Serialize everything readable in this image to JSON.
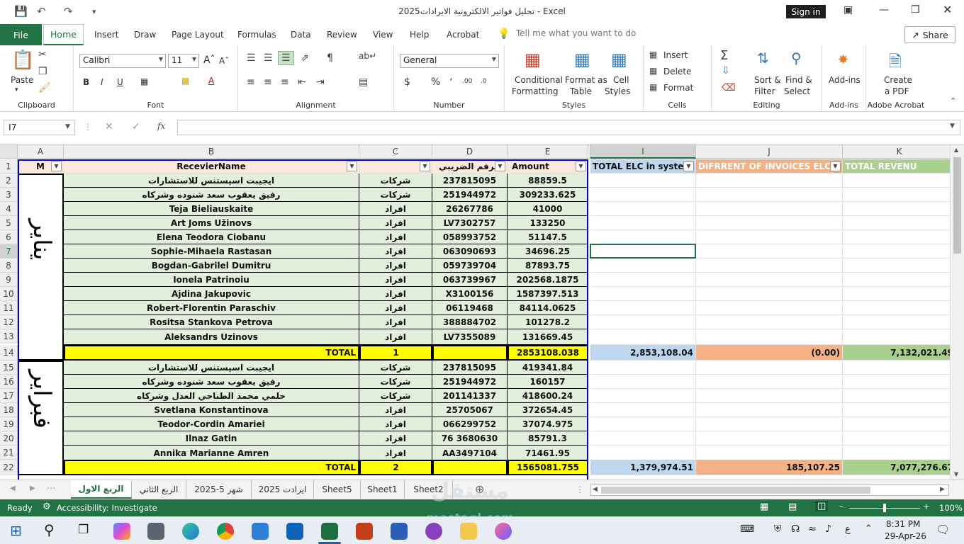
{
  "window": {
    "title": "تحليل فواتير الالكترونية الايرادات2025  -  Excel",
    "signin": "Sign in"
  },
  "tabs": {
    "file": "File",
    "home": "Home",
    "items": [
      "Insert",
      "Draw",
      "Page Layout",
      "Formulas",
      "Data",
      "Review",
      "View",
      "Help",
      "Acrobat"
    ],
    "tellme": "Tell me what you want to do",
    "share": "Share"
  },
  "ribbon": {
    "clipboard": {
      "label": "Clipboard",
      "paste": "Paste"
    },
    "font": {
      "label": "Font",
      "name": "Calibri",
      "size": "11"
    },
    "alignment": {
      "label": "Alignment"
    },
    "number": {
      "label": "Number",
      "format": "General"
    },
    "styles": {
      "label": "Styles",
      "cond1": "Conditional",
      "cond2": "Formatting",
      "fmt1": "Format as",
      "fmt2": "Table",
      "cell1": "Cell",
      "cell2": "Styles"
    },
    "cells": {
      "label": "Cells",
      "insert": "Insert",
      "delete": "Delete",
      "format": "Format"
    },
    "editing": {
      "label": "Editing",
      "sort1": "Sort &",
      "sort2": "Filter",
      "find1": "Find &",
      "find2": "Select"
    },
    "addins": {
      "label": "Add-ins",
      "btn": "Add-ins"
    },
    "acrobat": {
      "label": "Adobe Acrobat",
      "b1": "Create",
      "b2": "a PDF"
    }
  },
  "formula": {
    "namebox": "I7",
    "fx": "fx",
    "value": ""
  },
  "columns": [
    "A",
    "B",
    "C",
    "D",
    "E",
    "",
    "I",
    "J",
    "K"
  ],
  "header": {
    "a": "M",
    "b": "RecevierName",
    "c": "",
    "d": "الرقم الضريبي",
    "e": "Amount",
    "i": "TOTAL ELC in system",
    "j": "DIFRRENT OF INVOICES ELC",
    "k": "TOTAL REVENU"
  },
  "month1": "يناير",
  "month2": "فبراير",
  "rows1": [
    {
      "n": "2",
      "name": "ايجيبت اسيستنس للاستشارات",
      "type": "شركات",
      "tax": "237815095",
      "amount": "88859.5"
    },
    {
      "n": "3",
      "name": "رفيق يعقوب سعد شنوده وشركاه",
      "type": "شركات",
      "tax": "251944972",
      "amount": "309233.625"
    },
    {
      "n": "4",
      "name": "Teja Bieliauskaite",
      "type": "افراد",
      "tax": "26267786",
      "amount": "41000"
    },
    {
      "n": "5",
      "name": "Art Joms Užinovs",
      "type": "افراد",
      "tax": "LV7302757",
      "amount": "133250"
    },
    {
      "n": "6",
      "name": "Elena Teodora Ciobanu",
      "type": "افراد",
      "tax": "058993752",
      "amount": "51147.5"
    },
    {
      "n": "7",
      "name": "Sophie-Mihaela Rastasan",
      "type": "افراد",
      "tax": "063090693",
      "amount": "34696.25"
    },
    {
      "n": "8",
      "name": "Bogdan-Gabrilel Dumitru",
      "type": "افراد",
      "tax": "059739704",
      "amount": "87893.75"
    },
    {
      "n": "9",
      "name": "Ionela Patrinoiu",
      "type": "افراد",
      "tax": "063739967",
      "amount": "202568.1875"
    },
    {
      "n": "10",
      "name": "Ajdina Jakupovic",
      "type": "افراد",
      "tax": "X3100156",
      "amount": "1587397.513"
    },
    {
      "n": "11",
      "name": "Robert-Florentin Paraschiv",
      "type": "افراد",
      "tax": "06119468",
      "amount": "84114.0625"
    },
    {
      "n": "12",
      "name": "Rositsa Stankova Petrova",
      "type": "افراد",
      "tax": "388884702",
      "amount": "101278.2"
    },
    {
      "n": "13",
      "name": "Aleksandrs Uzinovs",
      "type": "افراد",
      "tax": "LV7355089",
      "amount": "131669.45"
    }
  ],
  "total1": {
    "n": "14",
    "label": "TOTAL",
    "c": "1",
    "amount": "2853108.038",
    "i": "2,853,108.04",
    "j": "(0.00)",
    "k": "7,132,021.49"
  },
  "rows2": [
    {
      "n": "15",
      "name": "ايجيبت اسيستنس للاستشارات",
      "type": "شركات",
      "tax": "237815095",
      "amount": "419341.84"
    },
    {
      "n": "16",
      "name": "رفيق يعقوب سعد شنوده وشركاه",
      "type": "شركات",
      "tax": "251944972",
      "amount": "160157"
    },
    {
      "n": "17",
      "name": "حلمي محمد الطناحي العدل وشركاه",
      "type": "شركات",
      "tax": "201141337",
      "amount": "418600.24"
    },
    {
      "n": "18",
      "name": "Svetlana Konstantinova",
      "type": "افراد",
      "tax": "25705067",
      "amount": "372654.45"
    },
    {
      "n": "19",
      "name": "Teodor-Cordin Amariei",
      "type": "افراد",
      "tax": "066299752",
      "amount": "37074.975"
    },
    {
      "n": "20",
      "name": "Ilnaz Gatin",
      "type": "افراد",
      "tax": "76 3680630",
      "amount": "85791.3"
    },
    {
      "n": "21",
      "name": "Annika Marianne Amren",
      "type": "افراد",
      "tax": "AA3497104",
      "amount": "71461.95"
    }
  ],
  "total2": {
    "n": "22",
    "label": "TOTAL",
    "c": "2",
    "amount": "1565081.755",
    "i": "1,379,974.51",
    "j": "185,107.25",
    "k": "7,077,276.67"
  },
  "sheets": [
    "الربع الاول",
    "الربع الثاني",
    "شهر 5-2025",
    "ايرادت 2025",
    "Sheet5",
    "Sheet1",
    "Sheet2"
  ],
  "status": {
    "ready": "Ready",
    "accessibility": "Accessibility: Investigate",
    "zoom": "100%"
  },
  "taskbar": {
    "time": "8:31 PM",
    "date": "29-Apr-26",
    "lang": "ع"
  },
  "watermark": {
    "text": "mostaql.com"
  }
}
